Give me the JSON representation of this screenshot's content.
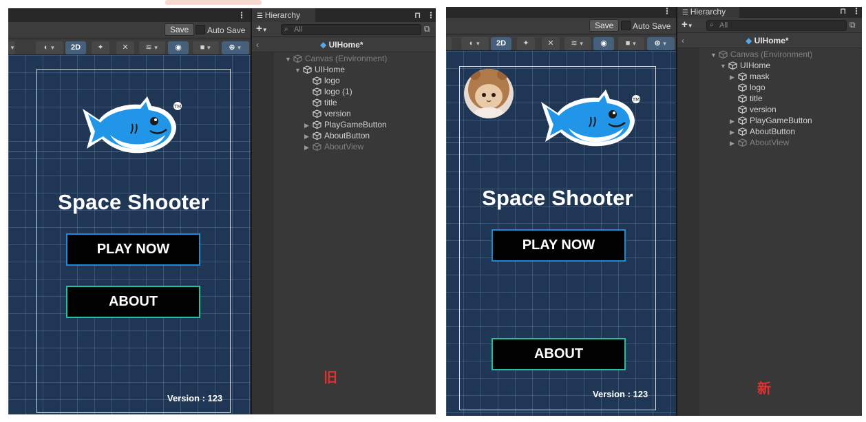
{
  "toolbar": {
    "save_label": "Save",
    "auto_save_label": "Auto Save",
    "mode_2d_label": "2D"
  },
  "hierarchy": {
    "tab_label": "Hierarchy",
    "search_placeholder": "All",
    "scene_name": "UIHome*"
  },
  "game": {
    "title": "Space Shooter",
    "play_label": "PLAY NOW",
    "about_label": "ABOUT",
    "version_text": "Version : 123"
  },
  "old": {
    "caption": "旧",
    "tree": [
      {
        "label": "Canvas (Environment)",
        "depth": 0,
        "arrow": "down",
        "dim": true
      },
      {
        "label": "UIHome",
        "depth": 1,
        "arrow": "down",
        "dim": false
      },
      {
        "label": "logo",
        "depth": 2,
        "arrow": "none",
        "dim": false
      },
      {
        "label": "logo (1)",
        "depth": 2,
        "arrow": "none",
        "dim": false
      },
      {
        "label": "title",
        "depth": 2,
        "arrow": "none",
        "dim": false
      },
      {
        "label": "version",
        "depth": 2,
        "arrow": "none",
        "dim": false
      },
      {
        "label": "PlayGameButton",
        "depth": 2,
        "arrow": "right",
        "dim": false
      },
      {
        "label": "AboutButton",
        "depth": 2,
        "arrow": "right",
        "dim": false
      },
      {
        "label": "AboutView",
        "depth": 2,
        "arrow": "right",
        "dim": true
      }
    ]
  },
  "new": {
    "caption": "新",
    "tree": [
      {
        "label": "Canvas (Environment)",
        "depth": 0,
        "arrow": "down",
        "dim": true
      },
      {
        "label": "UIHome",
        "depth": 1,
        "arrow": "down",
        "dim": false
      },
      {
        "label": "mask",
        "depth": 2,
        "arrow": "right",
        "dim": false
      },
      {
        "label": "logo",
        "depth": 2,
        "arrow": "none",
        "dim": false
      },
      {
        "label": "title",
        "depth": 2,
        "arrow": "none",
        "dim": false
      },
      {
        "label": "version",
        "depth": 2,
        "arrow": "none",
        "dim": false
      },
      {
        "label": "PlayGameButton",
        "depth": 2,
        "arrow": "right",
        "dim": false
      },
      {
        "label": "AboutButton",
        "depth": 2,
        "arrow": "right",
        "dim": false
      },
      {
        "label": "AboutView",
        "depth": 2,
        "arrow": "right",
        "dim": true
      }
    ]
  },
  "colors": {
    "scene_bg": "#1f3754",
    "play_border": "#1e88d2",
    "about_border": "#1ec3a3",
    "shark_blue": "#2196e8",
    "caption_red": "#e03030"
  }
}
